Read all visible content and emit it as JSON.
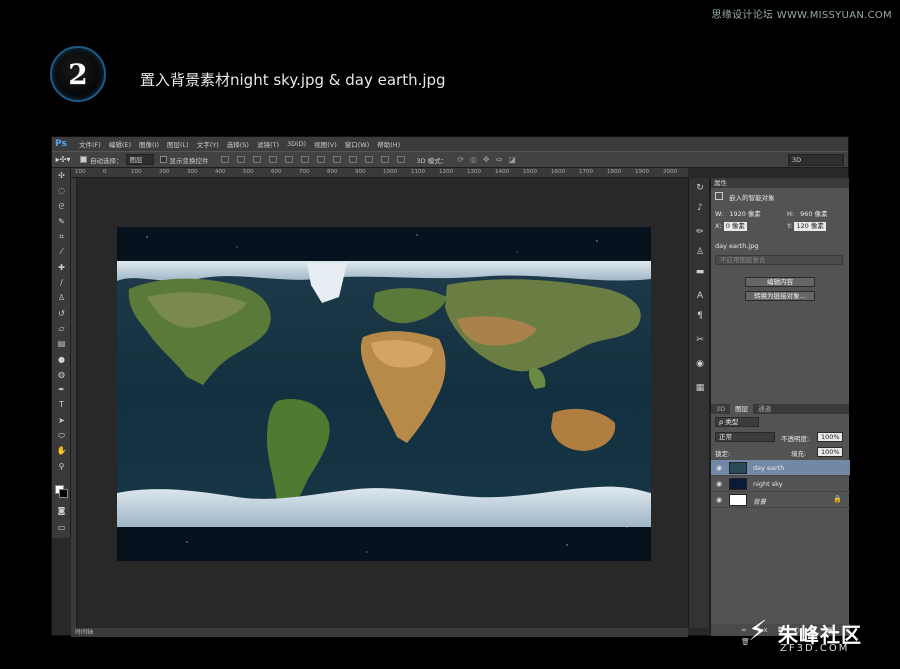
{
  "watermark_top": "思缘设计论坛 WWW.MISSYUAN.COM",
  "step": {
    "number": "2",
    "title": "置入背景素材night sky.jpg & day earth.jpg"
  },
  "app": {
    "logo": "Ps",
    "menu": [
      "文件(F)",
      "编辑(E)",
      "图像(I)",
      "图层(L)",
      "文字(Y)",
      "选择(S)",
      "滤镜(T)",
      "3D(D)",
      "视图(V)",
      "窗口(W)",
      "帮助(H)"
    ],
    "options": {
      "auto_select_label": "自动选择：",
      "auto_select_value": "图层",
      "show_transform_label": "显示变换控件",
      "mode_3d_label": "3D 模式：",
      "workspace": "3D"
    },
    "ruler_ticks": [
      "100",
      "0",
      "100",
      "200",
      "300",
      "400",
      "500",
      "600",
      "700",
      "800",
      "900",
      "1000",
      "1100",
      "1200",
      "1300",
      "1400",
      "1500",
      "1600",
      "1700",
      "1800",
      "1900",
      "2000"
    ],
    "status_bar": "时间轴"
  },
  "properties": {
    "panel_title": "属性",
    "smart_object_label": "嵌入的智能对象",
    "w_label": "W:",
    "w_value": "1920 像素",
    "h_label": "H:",
    "h_value": "960 像素",
    "x_label": "X:",
    "x_value": "0 像素",
    "y_label": "Y:",
    "y_value": "120 像素",
    "file_name": "day earth.jpg",
    "comp_placeholder": "不应用图层复合",
    "edit_button": "编辑内容",
    "convert_button": "转换为链接对象..."
  },
  "layers": {
    "tabs": [
      "3D",
      "图层",
      "通道"
    ],
    "filter_kind": "ρ 类型",
    "blend_mode": "正常",
    "opacity_label": "不透明度:",
    "opacity_value": "100%",
    "lock_label": "锁定:",
    "fill_label": "填充:",
    "fill_value": "100%",
    "items": [
      {
        "name": "day earth",
        "active": true
      },
      {
        "name": "night sky",
        "active": false
      },
      {
        "name": "背景",
        "active": false
      }
    ],
    "footer_icons": "∞ fx ◘ ◐ ▭ ▣ 🗑"
  },
  "watermark_bottom": {
    "cn": "朱峰社区",
    "en": "ZF3D.COM"
  }
}
